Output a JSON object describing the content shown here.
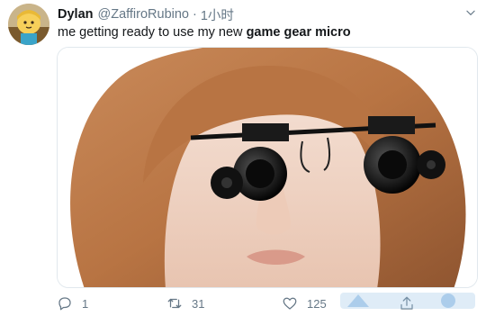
{
  "tweet": {
    "author_name": "Dylan",
    "handle": "@ZaffiroRubino",
    "separator": "·",
    "time": "1小时",
    "text_prefix": "me getting ready to use my new ",
    "text_bold": "game gear micro",
    "media_alt": "Mannequin head with red wig wearing jeweler's magnifying glasses with LED lights"
  },
  "actions": {
    "replies": "1",
    "retweets": "31",
    "likes": "125"
  },
  "icons": {
    "caret": "chevron-down-icon",
    "reply": "reply-icon",
    "retweet": "retweet-icon",
    "like": "heart-icon",
    "share": "share-icon"
  },
  "colors": {
    "text": "#14171a",
    "muted": "#657786",
    "border": "#e1e8ed"
  }
}
